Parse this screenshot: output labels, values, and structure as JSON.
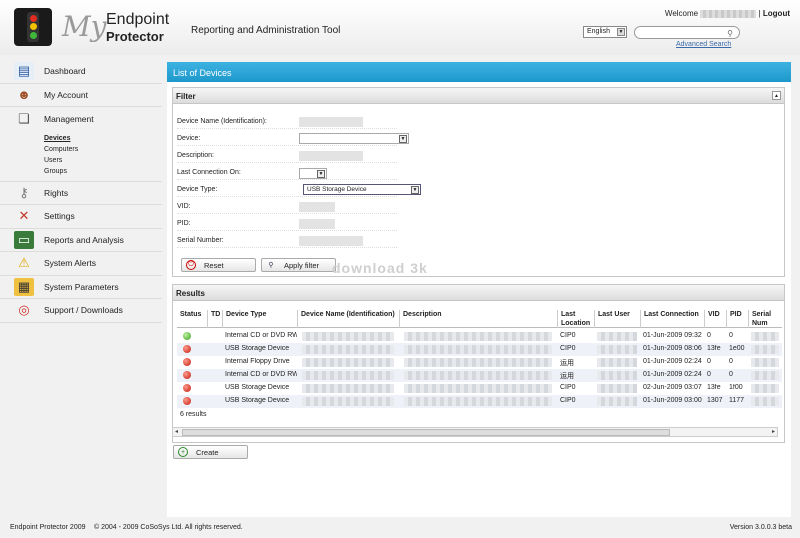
{
  "header": {
    "logo_my": "My",
    "logo_endpoint": "Endpoint",
    "logo_protector": "Protector",
    "title": "Reporting and Administration Tool",
    "welcome": "Welcome",
    "logout": "Logout",
    "language": "English",
    "search_placeholder": "",
    "advanced_search": "Advanced Search"
  },
  "sidebar": {
    "items": [
      {
        "label": "Dashboard",
        "icon": "dashboard-icon"
      },
      {
        "label": "My Account",
        "icon": "user-icon"
      },
      {
        "label": "Management",
        "icon": "management-icon"
      },
      {
        "label": "Rights",
        "icon": "keys-icon"
      },
      {
        "label": "Settings",
        "icon": "tools-icon"
      },
      {
        "label": "Reports and Analysis",
        "icon": "monitor-icon"
      },
      {
        "label": "System Alerts",
        "icon": "warning-icon"
      },
      {
        "label": "System Parameters",
        "icon": "parameters-icon"
      },
      {
        "label": "Support / Downloads",
        "icon": "lifebuoy-icon"
      }
    ],
    "management_sub": [
      "Devices",
      "Computers",
      "Users",
      "Groups"
    ]
  },
  "main": {
    "title": "List of Devices"
  },
  "filter": {
    "title": "Filter",
    "fields": {
      "device_name": "Device Name (Identification):",
      "device": "Device:",
      "description": "Description:",
      "last_connection": "Last Connection On:",
      "device_type": "Device Type:",
      "vid": "VID:",
      "pid": "PID:",
      "serial": "Serial Number:"
    },
    "device_type_value": "USB Storage Device",
    "reset_label": "Reset",
    "apply_label": "Apply filter"
  },
  "watermark": "download 3k",
  "results": {
    "title": "Results",
    "columns": [
      "Status",
      "TD",
      "Device Type",
      "Device Name (Identification)",
      "Description",
      "Last Location",
      "Last User",
      "Last Connection",
      "VID",
      "PID",
      "Serial Num"
    ],
    "rows": [
      {
        "status": "green",
        "type": "Internal CD or DVD RW",
        "location": "CIP0",
        "connection": "01-Jun-2009 09:32",
        "vid": "0",
        "pid": "0"
      },
      {
        "status": "red",
        "type": "USB Storage Device",
        "location": "CIP0",
        "connection": "01-Jun-2009 08:06",
        "vid": "13fe",
        "pid": "1e00"
      },
      {
        "status": "red",
        "type": "Internal Floppy Drive",
        "location": "运用",
        "connection": "01-Jun-2009 02:24",
        "vid": "0",
        "pid": "0"
      },
      {
        "status": "red",
        "type": "Internal CD or DVD RW",
        "location": "运用",
        "connection": "01-Jun-2009 02:24",
        "vid": "0",
        "pid": "0"
      },
      {
        "status": "red",
        "type": "USB Storage Device",
        "location": "CIP0",
        "connection": "02-Jun-2009 03:07",
        "vid": "13fe",
        "pid": "1f00"
      },
      {
        "status": "red",
        "type": "USB Storage Device",
        "location": "CIP0",
        "connection": "01-Jun-2009 03:00",
        "vid": "1307",
        "pid": "1177"
      }
    ],
    "count_text": "6 results"
  },
  "create_label": "Create",
  "footer": {
    "left": "Endpoint Protector 2009",
    "copyright": "© 2004 - 2009 CoSoSys Ltd. All rights reserved.",
    "version": "Version 3.0.0.3 beta"
  },
  "colors": {
    "accent": "#26a2d4",
    "status_ok": "#3a9a23",
    "status_off": "#c01a0f"
  }
}
